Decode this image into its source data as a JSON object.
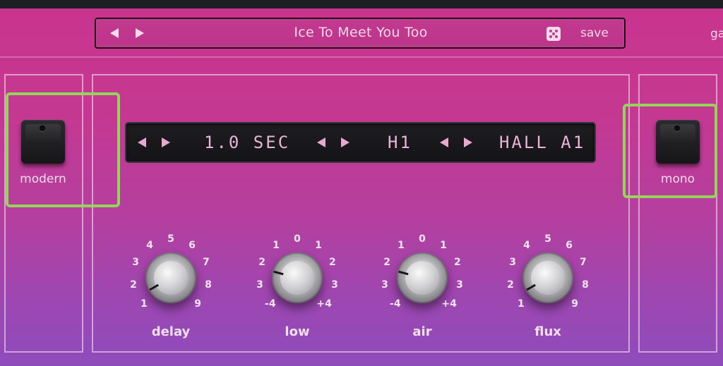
{
  "header": {
    "preset_name": "Ice To Meet You Too",
    "save_label": "save",
    "right_truncated": "ga"
  },
  "left_button": {
    "label": "modern"
  },
  "right_button": {
    "label": "mono"
  },
  "display": {
    "time": "1.0 SEC",
    "mode": "H1",
    "type": "HALL A1"
  },
  "knobs": [
    {
      "label": "delay",
      "ticks": [
        "1",
        "2",
        "3",
        "4",
        "5",
        "6",
        "7",
        "8",
        "9"
      ]
    },
    {
      "label": "low",
      "ticks": [
        "-4",
        "3",
        "2",
        "1",
        "0",
        "1",
        "2",
        "3",
        "+4"
      ]
    },
    {
      "label": "air",
      "ticks": [
        "-4",
        "3",
        "2",
        "1",
        "0",
        "1",
        "2",
        "3",
        "+4"
      ]
    },
    {
      "label": "flux",
      "ticks": [
        "1",
        "2",
        "3",
        "4",
        "5",
        "6",
        "7",
        "8",
        "9"
      ]
    }
  ],
  "colors": {
    "highlight": "#94d45a",
    "lcd_text": "#e9b4d7",
    "background_top": "#c8348e",
    "background_bottom": "#8e4cba"
  }
}
